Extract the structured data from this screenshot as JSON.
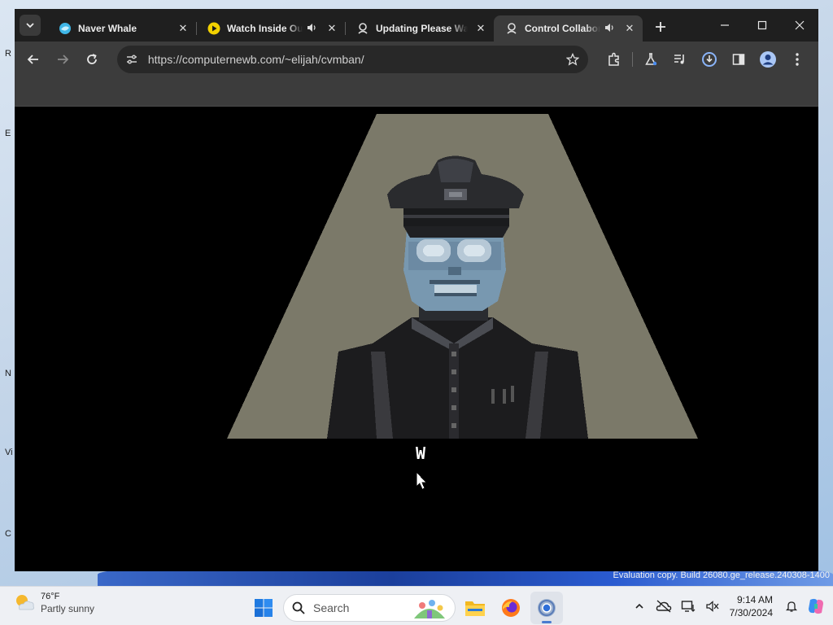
{
  "desktop": {
    "edge_labels": [
      "R",
      "E",
      "N",
      "Vi",
      "C"
    ],
    "watermark": "Evaluation copy. Build 26080.ge_release.240308-1400"
  },
  "browser": {
    "tabs": [
      {
        "title": "Naver Whale",
        "favicon": "whale-icon",
        "audio": false,
        "active": false
      },
      {
        "title": "Watch Inside Out",
        "favicon": "play-icon",
        "audio": true,
        "active": false
      },
      {
        "title": "Updating Please Wait",
        "favicon": "seal-icon",
        "audio": false,
        "active": false
      },
      {
        "title": "Control Collaborate",
        "favicon": "seal-icon",
        "audio": true,
        "active": true
      }
    ],
    "url": "https://computernewb.com/~elijah/cvmban/",
    "colors": {
      "tabbar": "#1f1f1f",
      "toolbar": "#3c3c3c",
      "omnibox": "#282828"
    }
  },
  "content": {
    "scene": "pixel-art officer under spotlight",
    "cursor_glyph": "W"
  },
  "taskbar": {
    "weather": {
      "temp": "76°F",
      "condition": "Partly sunny"
    },
    "search_label": "Search",
    "clock": {
      "time": "9:14 AM",
      "date": "7/30/2024"
    },
    "apps": [
      "file-explorer-icon",
      "firefox-icon",
      "chrome-icon"
    ]
  }
}
